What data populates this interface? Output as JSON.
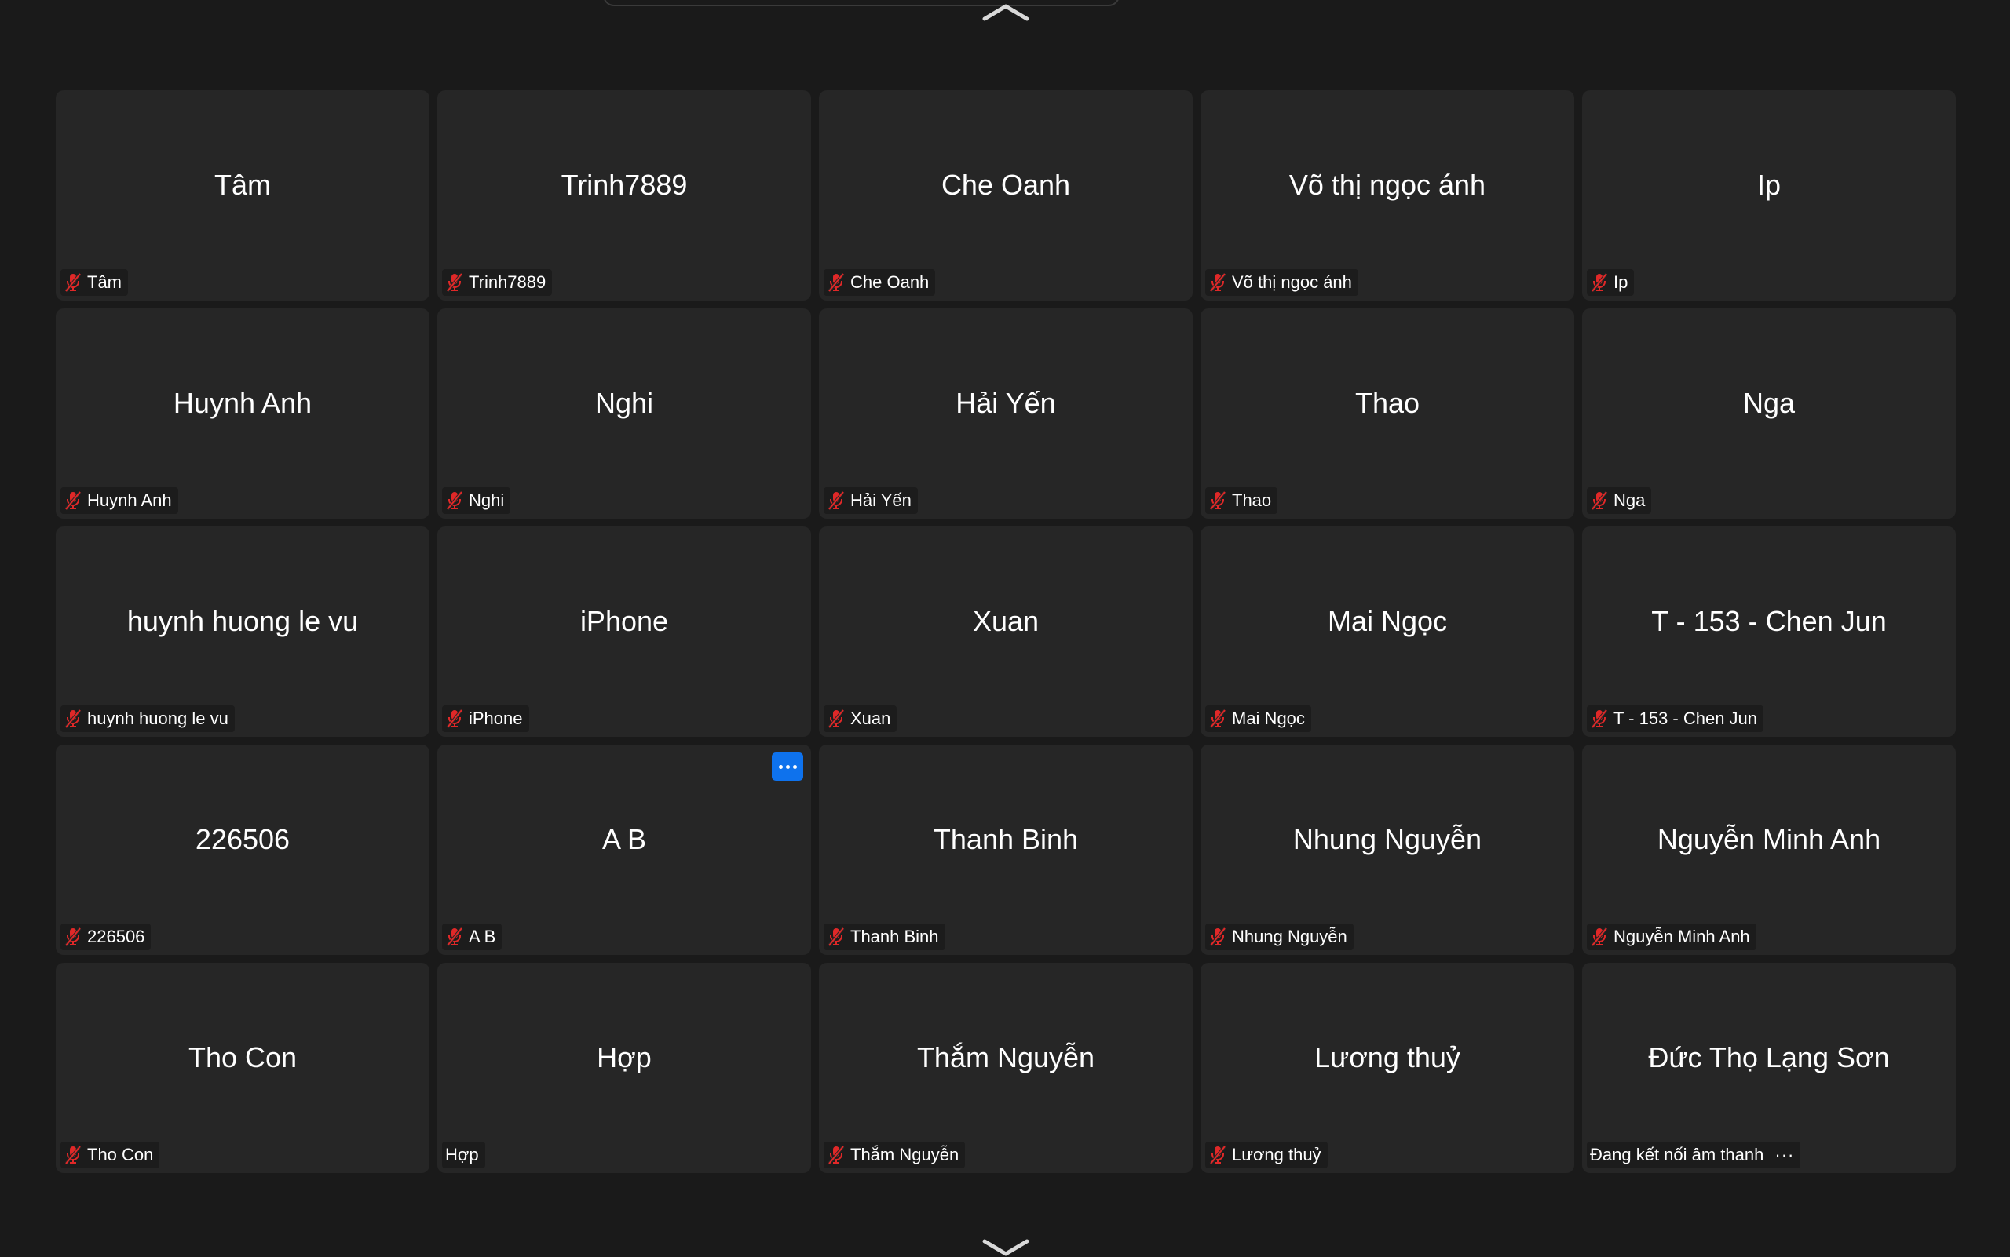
{
  "colors": {
    "background": "#1a1a1a",
    "tile": "#262626",
    "muted_icon": "#e02828",
    "more_button": "#0e72ed"
  },
  "participants": [
    {
      "name": "Tâm",
      "label": "Tâm",
      "muted": true
    },
    {
      "name": "Trinh7889",
      "label": "Trinh7889",
      "muted": true
    },
    {
      "name": "Che Oanh",
      "label": "Che Oanh",
      "muted": true
    },
    {
      "name": "Võ thị ngọc ánh",
      "label": "Võ thị ngọc ánh",
      "muted": true
    },
    {
      "name": "Ip",
      "label": "Ip",
      "muted": true
    },
    {
      "name": "Huynh Anh",
      "label": "Huynh Anh",
      "muted": true
    },
    {
      "name": "Nghi",
      "label": "Nghi",
      "muted": true
    },
    {
      "name": "Hải Yến",
      "label": "Hải Yến",
      "muted": true
    },
    {
      "name": "Thao",
      "label": "Thao",
      "muted": true
    },
    {
      "name": "Nga",
      "label": "Nga",
      "muted": true
    },
    {
      "name": "huynh huong le vu",
      "label": "huynh huong le vu",
      "muted": true
    },
    {
      "name": "iPhone",
      "label": "iPhone",
      "muted": true
    },
    {
      "name": "Xuan",
      "label": "Xuan",
      "muted": true
    },
    {
      "name": "Mai Ngọc",
      "label": "Mai Ngọc",
      "muted": true
    },
    {
      "name": "T - 153 - Chen Jun",
      "label": "T - 153 - Chen Jun",
      "muted": true
    },
    {
      "name": "226506",
      "label": "226506",
      "muted": true
    },
    {
      "name": "A B",
      "label": "A B",
      "muted": true,
      "more_button": true,
      "more_icon": "ellipsis-icon"
    },
    {
      "name": "Thanh Binh",
      "label": "Thanh Binh",
      "muted": true
    },
    {
      "name": "Nhung Nguyễn",
      "label": "Nhung Nguyễn",
      "muted": true
    },
    {
      "name": "Nguyễn Minh Anh",
      "label": "Nguyễn Minh Anh",
      "muted": true
    },
    {
      "name": "Tho Con",
      "label": "Tho Con",
      "muted": true
    },
    {
      "name": "Hợp",
      "label": "Hợp",
      "muted": false
    },
    {
      "name": "Thắm Nguyễn",
      "label": "Thắm Nguyễn",
      "muted": true
    },
    {
      "name": "Lương thuỷ",
      "label": "Lương thuỷ",
      "muted": true
    },
    {
      "name": "Đức Thọ Lạng Sơn",
      "label": "Đang kết nối âm thanh",
      "muted": false,
      "connecting": true,
      "connecting_indicator": "···"
    }
  ]
}
